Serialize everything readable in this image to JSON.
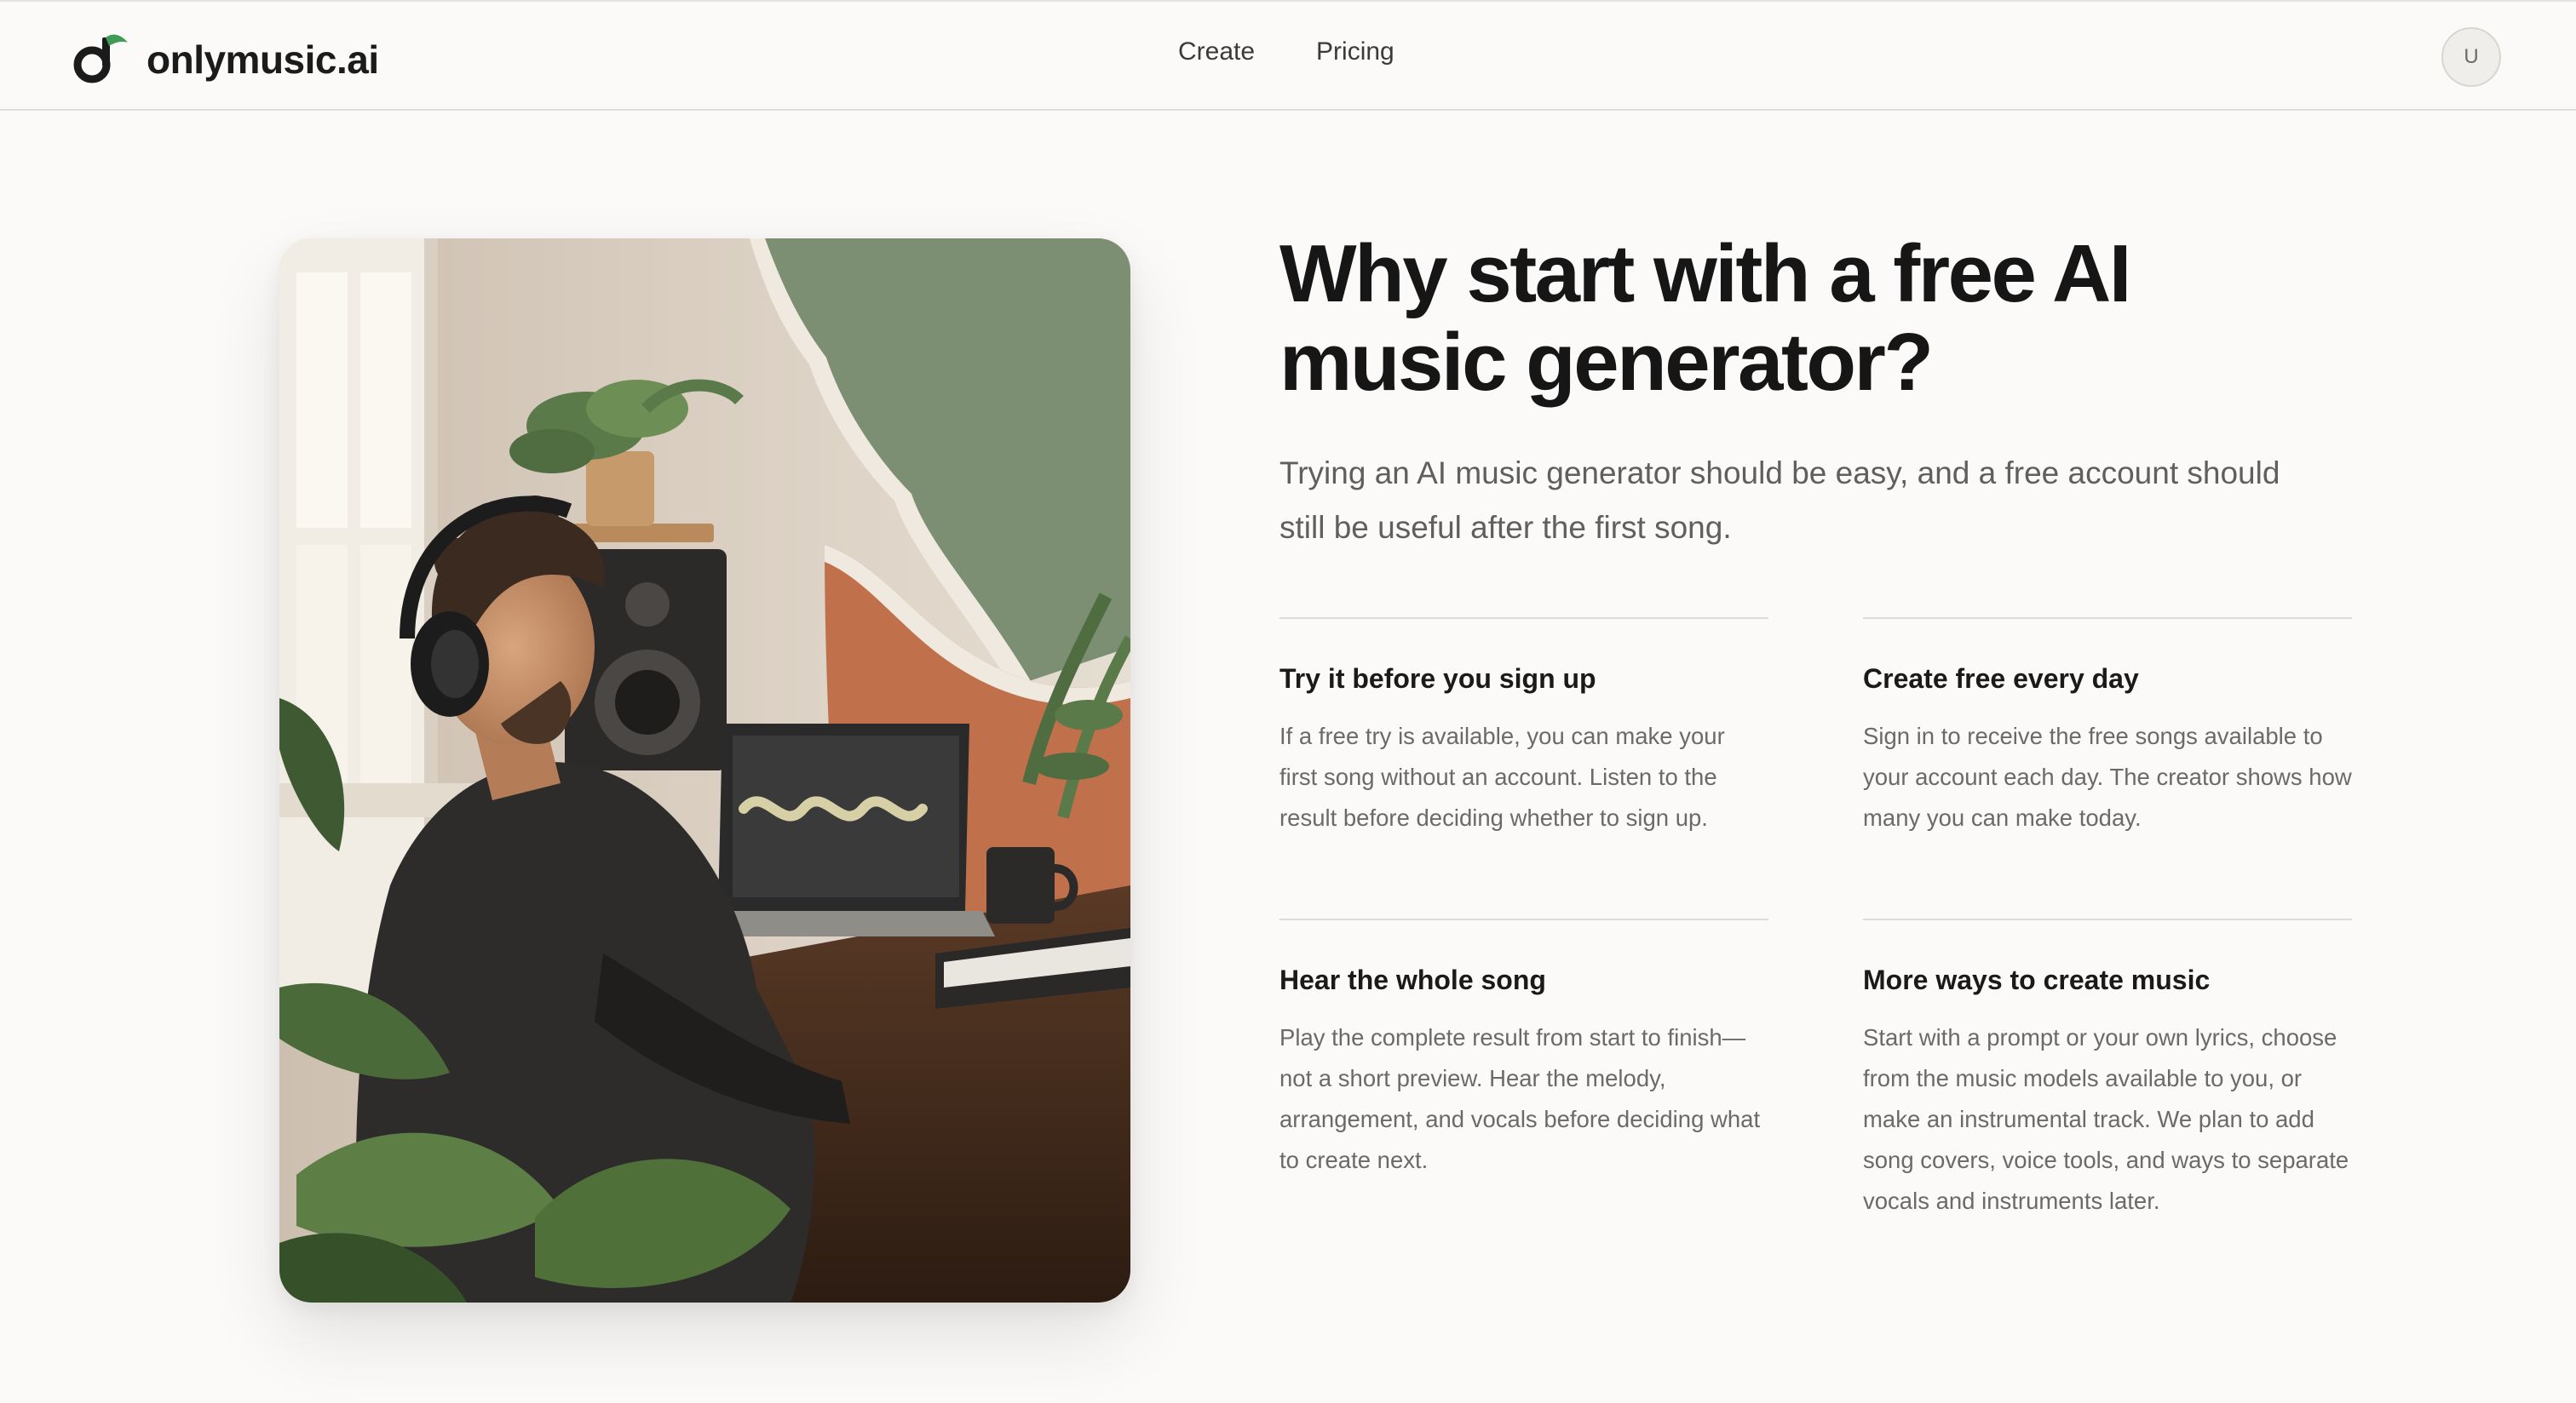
{
  "brand": {
    "name": "onlymusic.ai",
    "colors": {
      "accent_green": "#3f9b57",
      "ink": "#1b1b1b",
      "background": "#fbfaf8"
    }
  },
  "nav": {
    "items": [
      {
        "label": "Create"
      },
      {
        "label": "Pricing"
      }
    ]
  },
  "user": {
    "avatar_initial": "U"
  },
  "hero": {
    "image_icon": "music-listener-photo"
  },
  "section": {
    "title": "Why start with a free AI music generator?",
    "intro": "Trying an AI music generator should be easy, and a free account should still be useful after the first song.",
    "features": [
      {
        "title": "Try it before you sign up",
        "body": "If a free try is available, you can make your first song without an account. Listen to the result before deciding whether to sign up."
      },
      {
        "title": "Create free every day",
        "body": "Sign in to receive the free songs available to your account each day. The creator shows how many you can make today."
      },
      {
        "title": "Hear the whole song",
        "body": "Play the complete result from start to finish—not a short preview. Hear the melody, arrangement, and vocals before deciding what to create next."
      },
      {
        "title": "More ways to create music",
        "body": "Start with a prompt or your own lyrics, choose from the music models available to you, or make an instrumental track. We plan to add song covers, voice tools, and ways to separate vocals and instruments later."
      }
    ]
  }
}
